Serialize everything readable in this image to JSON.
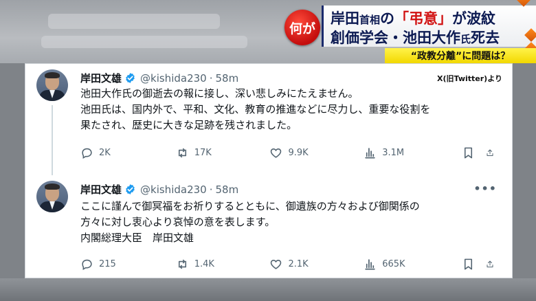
{
  "banner": {
    "question": "何が",
    "line1": {
      "a": "岸田",
      "b": "首相",
      "c": "の",
      "d": "「弔意」",
      "e": "が波紋"
    },
    "line2": {
      "a": "創価学会・池田大作",
      "b": "氏",
      "c": "死去"
    },
    "sub": "“政教分離”に問題は？"
  },
  "source_label": "X(旧Twitter)より",
  "colors": {
    "banner_navy": "#0c1a52",
    "accent_red": "#d11111",
    "sub_yellow": "#f7e21a",
    "verified_blue": "#1d9bf0"
  },
  "tweets": [
    {
      "name": "岸田文雄",
      "handle": "@kishida230",
      "sep": "·",
      "time": "58m",
      "lines": [
        "池田大作氏の御逝去の報に接し、深い悲しみにたえません。",
        "池田氏は、国内外で、平和、文化、教育の推進などに尽力し、重要な役割を",
        "果たされ、歴史に大きな足跡を残されました。"
      ],
      "replies": "2K",
      "reposts": "17K",
      "likes": "9.9K",
      "views": "3.1M"
    },
    {
      "name": "岸田文雄",
      "handle": "@kishida230",
      "sep": "·",
      "time": "58m",
      "more": "•••",
      "lines": [
        "ここに謹んで御冥福をお祈りするとともに、御遺族の方々および御関係の",
        "方々に対し衷心より哀悼の意を表します。",
        "内閣総理大臣　岸田文雄"
      ],
      "replies": "215",
      "reposts": "1.4K",
      "likes": "2.1K",
      "views": "665K"
    }
  ],
  "icons": [
    "reply-icon",
    "repost-icon",
    "like-icon",
    "views-icon",
    "bookmark-icon",
    "share-icon",
    "verified-badge-icon"
  ]
}
